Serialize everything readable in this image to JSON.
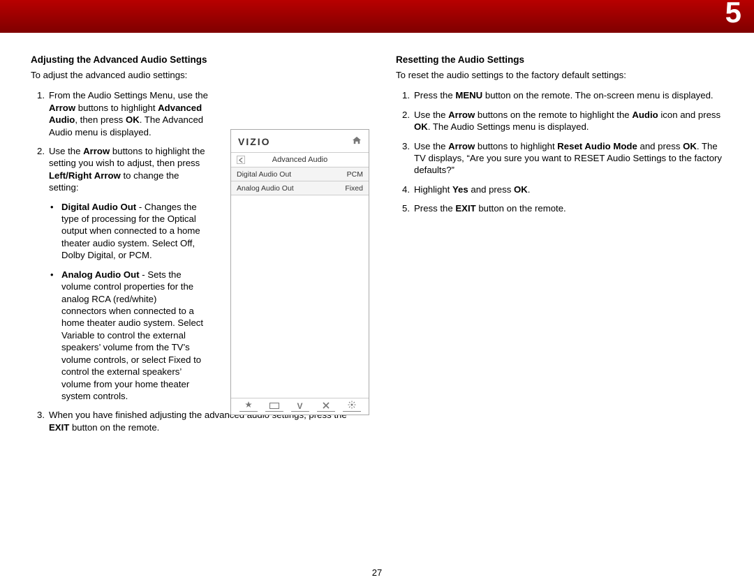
{
  "chapter_number": "5",
  "page_number": "27",
  "left": {
    "heading": "Adjusting the Advanced Audio Settings",
    "intro": "To adjust the advanced audio settings:",
    "steps": [
      {
        "num": "1.",
        "html": "From the Audio Settings Menu, use the <b>Arrow</b> buttons to highlight <b>Advanced Audio</b>, then press <b>OK</b>. The Advanced Audio menu is displayed."
      },
      {
        "num": "2.",
        "html": "Use the <b>Arrow</b> buttons to highlight the setting you wish to adjust, then press <b>Left/Right Arrow</b> to change the setting:"
      },
      {
        "num": "3.",
        "html": "When you have finished adjusting the advanced audio settings, press the <b>EXIT</b> button on the remote."
      }
    ],
    "bullets": [
      {
        "html": "<b>Digital Audio Out</b> - Changes the type of processing for the Optical output when connected to a home theater audio system. Select Off, Dolby Digital, or PCM."
      },
      {
        "html": "<b>Analog Audio Out</b> - Sets the volume control properties for the analog RCA (red/white) connectors when connected to a home theater audio system. Select Variable to control the external speakers’ volume from the TV’s volume controls, or select Fixed to control the external speakers’ volume from your home theater system controls."
      }
    ]
  },
  "right": {
    "heading": "Resetting the Audio Settings",
    "intro": "To reset the audio settings to the factory default settings:",
    "steps": [
      {
        "num": "1.",
        "html": "Press the <b>MENU</b> button on the remote. The on-screen menu is displayed."
      },
      {
        "num": "2.",
        "html": "Use the <b>Arrow</b> buttons on the remote to highlight the <b>Audio</b> icon and press <b>OK</b>. The Audio Settings menu is displayed."
      },
      {
        "num": "3.",
        "html": "Use the <b>Arrow</b> buttons to highlight <b>Reset Audio Mode</b> and press <b>OK</b>. The TV displays, “Are you sure you want to RESET Audio Settings to the factory defaults?”"
      },
      {
        "num": "4.",
        "html": "Highlight <b>Yes</b> and press <b>OK</b>."
      },
      {
        "num": "5.",
        "html": "Press the <b>EXIT</b> button on the remote."
      }
    ]
  },
  "menu": {
    "brand": "VIZIO",
    "title": "Advanced Audio",
    "rows": [
      {
        "label": "Digital Audio Out",
        "value": "PCM"
      },
      {
        "label": "Analog Audio Out",
        "value": "Fixed"
      }
    ],
    "footer_icons": [
      "star",
      "wide",
      "v",
      "x",
      "gear"
    ]
  }
}
